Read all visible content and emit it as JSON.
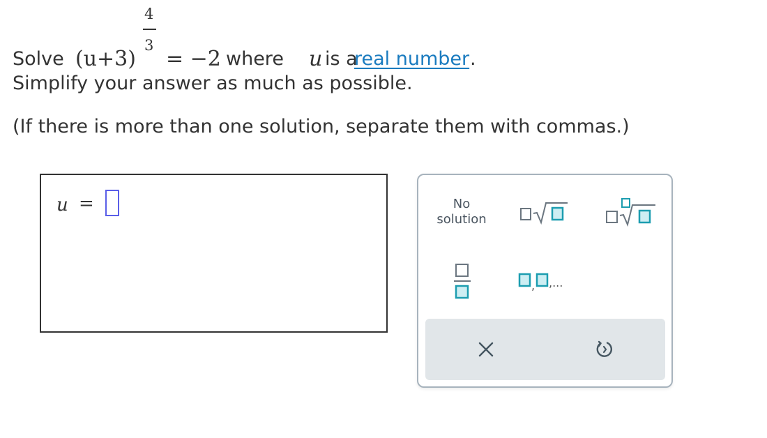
{
  "problem": {
    "solve_label": "Solve",
    "expression_base": "(u+3)",
    "exponent_numerator": "4",
    "exponent_denominator": "3",
    "rhs": "= −2",
    "where_label": "where",
    "variable": "u",
    "is_a_label": "is a",
    "link_text": "real number",
    "period": ".",
    "instruction": "Simplify your answer as much as possible.",
    "note": "(If there is more than one solution, separate them with commas.)"
  },
  "answer": {
    "variable": "u",
    "equals": "=",
    "input_value": ""
  },
  "keypad": {
    "no_solution_line1": "No",
    "no_solution_line2": "solution",
    "sqrt_key": "square-root-template",
    "nth_root_key": "nth-root-template",
    "fraction_key": "fraction-template",
    "list_key": "list-template",
    "list_ellipsis": ",...",
    "clear_key": "clear",
    "undo_key": "undo"
  },
  "colors": {
    "link": "#1a7bbf",
    "input_border": "#5a5ee8",
    "keypad_icon": "#1c9db0",
    "keypad_border": "#a7b3bd",
    "action_bar": "#e1e6e9"
  }
}
